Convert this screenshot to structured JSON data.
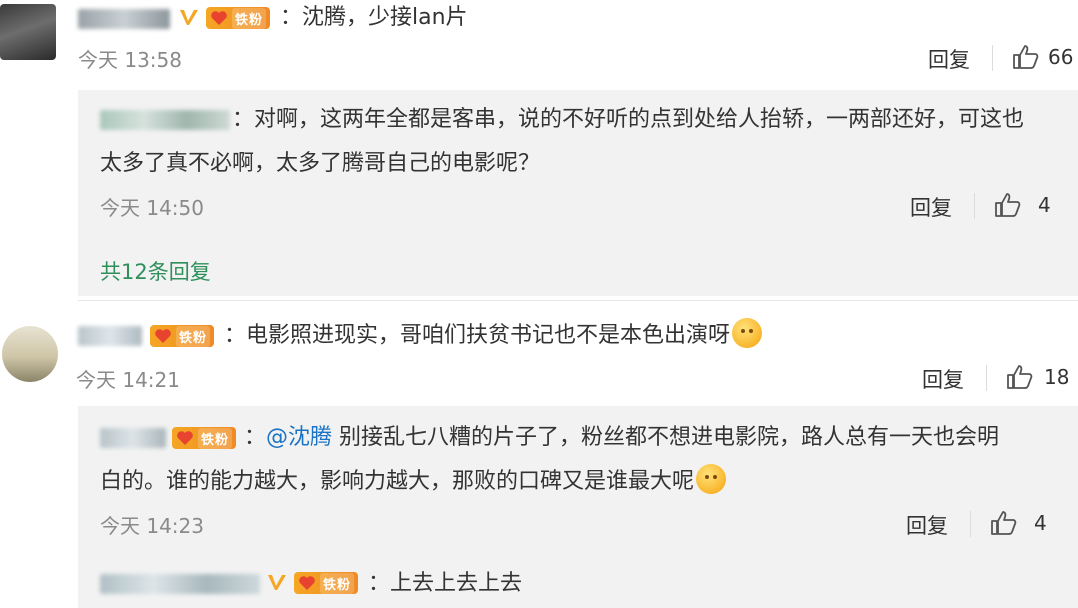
{
  "fan_badge_label": "铁粉",
  "comments": [
    {
      "text": "：沈腾，少接lan片",
      "time": "今天 13:58",
      "reply_label": "回复",
      "likes": "66",
      "replies": [
        {
          "text_line1": "：对啊，这两年全都是客串，说的不好听的点到处给人抬轿，一两部还好，可这也",
          "text_line2": "太多了真不必啊，太多了腾哥自己的电影呢？",
          "time": "今天 14:50",
          "reply_label": "回复",
          "likes": "4"
        }
      ],
      "more_replies": "共12条回复"
    },
    {
      "text": "：电影照进现实，哥咱们扶贫书记也不是本色出演呀",
      "time": "今天 14:21",
      "reply_label": "回复",
      "likes": "18",
      "replies": [
        {
          "prefix": "：",
          "mention": "@沈腾",
          "text_line1": " 别接乱七八糟的片子了，粉丝都不想进电影院，路人总有一天也会明",
          "text_line2": "白的。谁的能力越大，影响力越大，那败的口碑又是谁最大呢",
          "time": "今天 14:23",
          "reply_label": "回复",
          "likes": "4"
        },
        {
          "text_line1": "：上去上去上去"
        }
      ]
    }
  ]
}
